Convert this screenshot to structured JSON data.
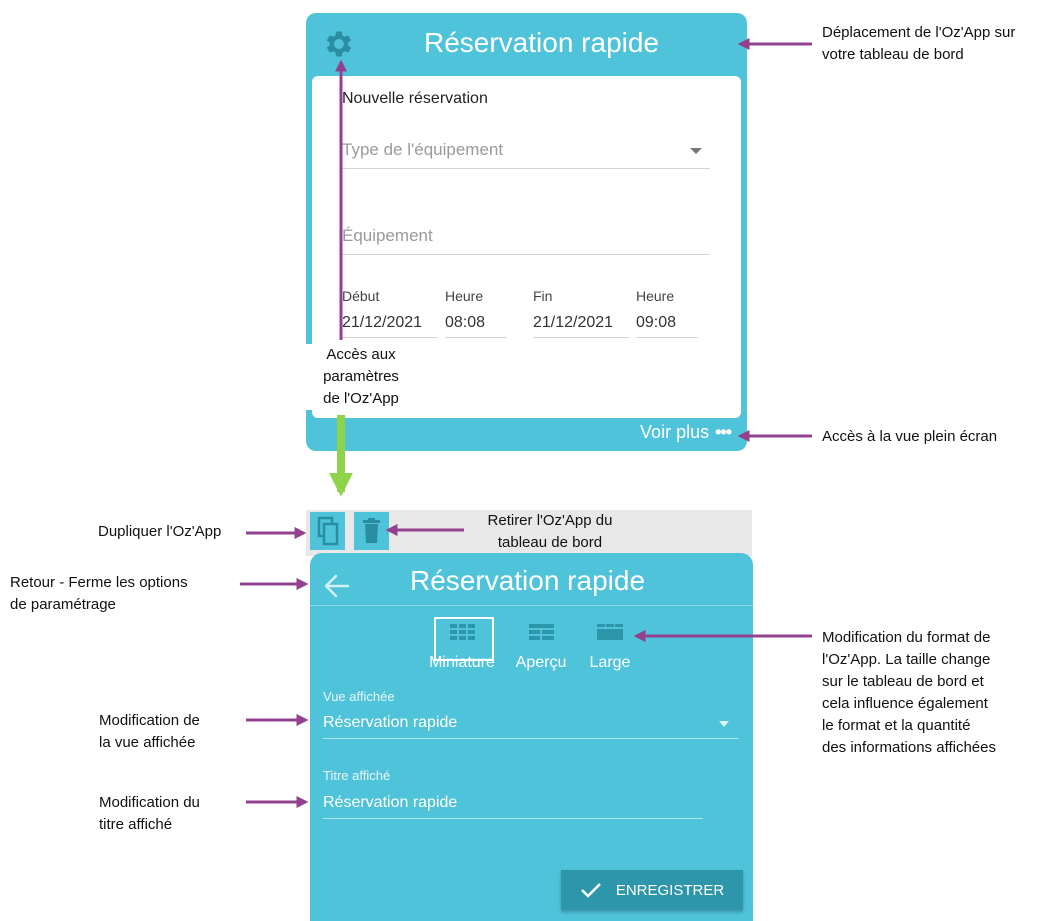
{
  "widget_top": {
    "title": "Réservation rapide",
    "section_title": "Nouvelle réservation",
    "type_placeholder": "Type de l'équipement",
    "equipment_placeholder": "Équipement",
    "start_label": "Début",
    "start_time_label": "Heure",
    "end_label": "Fin",
    "end_time_label": "Heure",
    "start_date": "21/12/2021",
    "start_time": "08:08",
    "end_date": "21/12/2021",
    "end_time": "09:08",
    "see_more": "Voir plus"
  },
  "panel": {
    "title": "Réservation rapide",
    "formats": [
      "Miniature",
      "Aperçu",
      "Large"
    ],
    "selected_format": "Miniature",
    "view_label": "Vue affichée",
    "view_value": "Réservation rapide",
    "title_label": "Titre affiché",
    "title_value": "Réservation rapide",
    "save_label": "ENREGISTRER"
  },
  "annotations": {
    "move_line1": "Déplacement de l'Oz'App sur",
    "move_line2": "votre tableau de bord",
    "settings_line1": "Accès aux",
    "settings_line2": "paramètres",
    "settings_line3": "de l'Oz'App",
    "fullscreen": "Accès à la vue plein écran",
    "duplicate": "Dupliquer l'Oz'App",
    "remove_line1": "Retirer l'Oz'App du",
    "remove_line2": "tableau de bord",
    "back_line1": "Retour - Ferme les options",
    "back_line2": "de paramétrage",
    "format_lines": [
      "Modification du format de",
      "l'Oz'App. La taille change",
      "sur le tableau de bord et",
      "cela influence également",
      "le format et la quantité",
      "des informations affichées"
    ],
    "view_line1": "Modification de",
    "view_line2": "la vue affichée",
    "title_line1": "Modification du",
    "title_line2": "titre affiché"
  },
  "colors": {
    "accent": "#4fc3d9",
    "button_dark": "#2e96aa",
    "arrow_purple": "#93408f",
    "arrow_green": "#8ed44a"
  }
}
